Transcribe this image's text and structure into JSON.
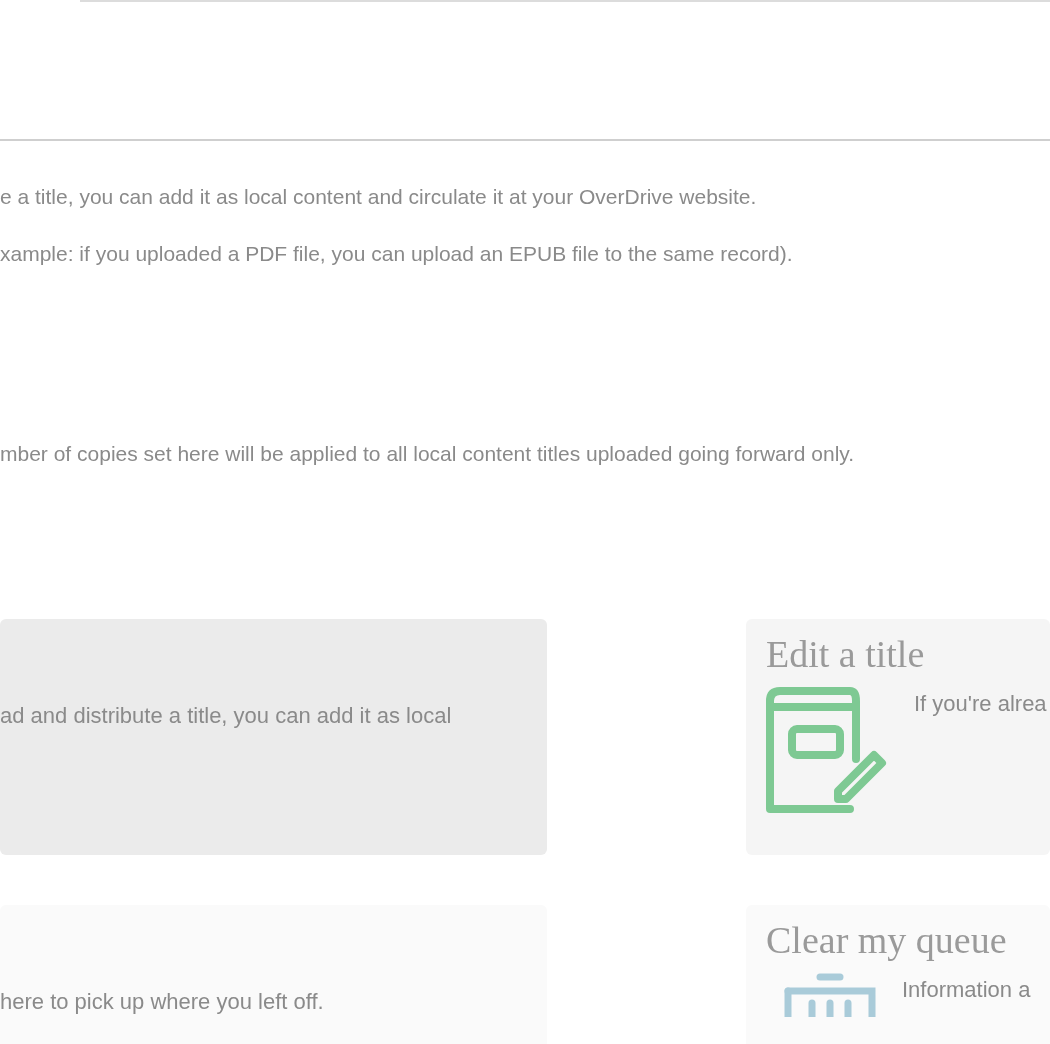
{
  "intro_paragraphs": [
    "e a title, you can add it as local content and circulate it at your OverDrive website.",
    "xample: if you uploaded a PDF file, you can upload an EPUB file to the same record)."
  ],
  "copies_note": "mber of copies set here will be applied to all local content titles uploaded going forward only.",
  "cards": [
    {
      "kind": "plain",
      "text": "ad and distribute a title, you can add it as local"
    },
    {
      "kind": "edit",
      "title": "Edit a title",
      "text": "If you're alrea"
    },
    {
      "kind": "plain",
      "text": "here to pick up where you left off."
    },
    {
      "kind": "trash",
      "title": "Clear my queue",
      "text": "Information a"
    }
  ]
}
